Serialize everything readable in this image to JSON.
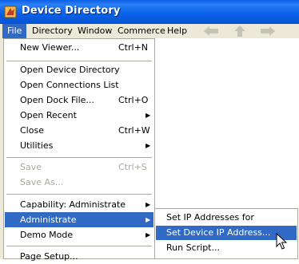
{
  "window": {
    "title": "Device Directory",
    "icon": "app-logo-icon"
  },
  "menubar": {
    "items": [
      "File",
      "Directory",
      "Window",
      "Commerce",
      "Help"
    ],
    "active": "File",
    "nav": [
      "back-arrow-icon",
      "up-arrow-icon",
      "forward-arrow-icon"
    ]
  },
  "file_menu": {
    "items": [
      {
        "label": "New Viewer...",
        "shortcut": "Ctrl+N"
      },
      {
        "label": "Open Device Directory",
        "shortcut": ""
      },
      {
        "label": "Open Connections List",
        "shortcut": ""
      },
      {
        "label": "Open Dock File...",
        "shortcut": "Ctrl+O"
      },
      {
        "label": "Open Recent",
        "shortcut": ""
      },
      {
        "label": "Close",
        "shortcut": "Ctrl+W"
      },
      {
        "label": "Utilities",
        "shortcut": ""
      },
      {
        "label": "Save",
        "shortcut": "Ctrl+S"
      },
      {
        "label": "Save As...",
        "shortcut": ""
      },
      {
        "label": "Capability: Administrate",
        "shortcut": ""
      },
      {
        "label": "Administrate",
        "shortcut": ""
      },
      {
        "label": "Demo Mode",
        "shortcut": ""
      },
      {
        "label": "Page Setup...",
        "shortcut": ""
      }
    ]
  },
  "administrate_submenu": {
    "items": [
      {
        "label": "Set IP Addresses for System..."
      },
      {
        "label": "Set Device IP Address..."
      },
      {
        "label": "Run Script..."
      }
    ]
  },
  "colors": {
    "titlebar": "#0a5ee6",
    "highlight": "#316ac5",
    "chrome": "#ece9d8"
  }
}
